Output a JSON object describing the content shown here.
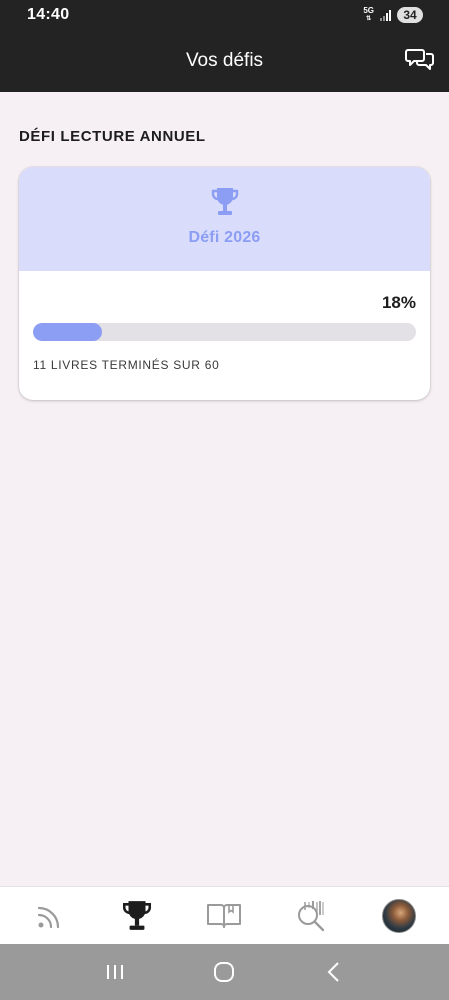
{
  "status_bar": {
    "time": "14:40",
    "network": "5G",
    "battery": "34"
  },
  "header": {
    "title": "Vos défis"
  },
  "section": {
    "title": "DÉFI LECTURE ANNUEL"
  },
  "challenge": {
    "name": "Défi 2026",
    "percent_label": "18%",
    "progress": 0.18,
    "status": "11 LIVRES TERMINÉS SUR 60"
  },
  "colors": {
    "accent": "#8c9ef4",
    "card_header_bg": "#dadcfc",
    "app_bar": "#232323",
    "page_bg": "#f6f0f4"
  },
  "bottom_nav": [
    {
      "icon": "feed-icon",
      "active": false
    },
    {
      "icon": "trophy-icon",
      "active": true
    },
    {
      "icon": "book-icon",
      "active": false
    },
    {
      "icon": "search-barcode-icon",
      "active": false
    },
    {
      "icon": "avatar",
      "active": false
    }
  ]
}
